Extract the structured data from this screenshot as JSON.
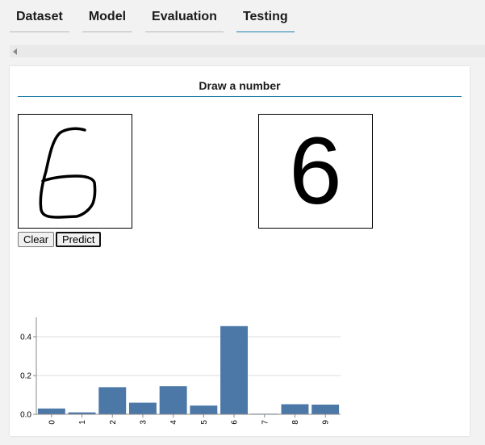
{
  "tabs": [
    {
      "label": "Dataset",
      "active": false
    },
    {
      "label": "Model",
      "active": false
    },
    {
      "label": "Evaluation",
      "active": false
    },
    {
      "label": "Testing",
      "active": true
    }
  ],
  "panel": {
    "title": "Draw a number",
    "prediction": "6",
    "clear_label": "Clear",
    "predict_label": "Predict"
  },
  "colors": {
    "accent": "#1e7fa8",
    "bar": "#4c78a8"
  },
  "chart_data": {
    "type": "bar",
    "categories": [
      "0",
      "1",
      "2",
      "3",
      "4",
      "5",
      "6",
      "7",
      "8",
      "9"
    ],
    "values": [
      0.03,
      0.01,
      0.14,
      0.06,
      0.145,
      0.045,
      0.455,
      0.003,
      0.052,
      0.05
    ],
    "yticks": [
      "0.0",
      "0.2",
      "0.4"
    ],
    "ylim": [
      0,
      0.5
    ],
    "grid": true,
    "title": "",
    "xlabel": "",
    "ylabel": ""
  }
}
